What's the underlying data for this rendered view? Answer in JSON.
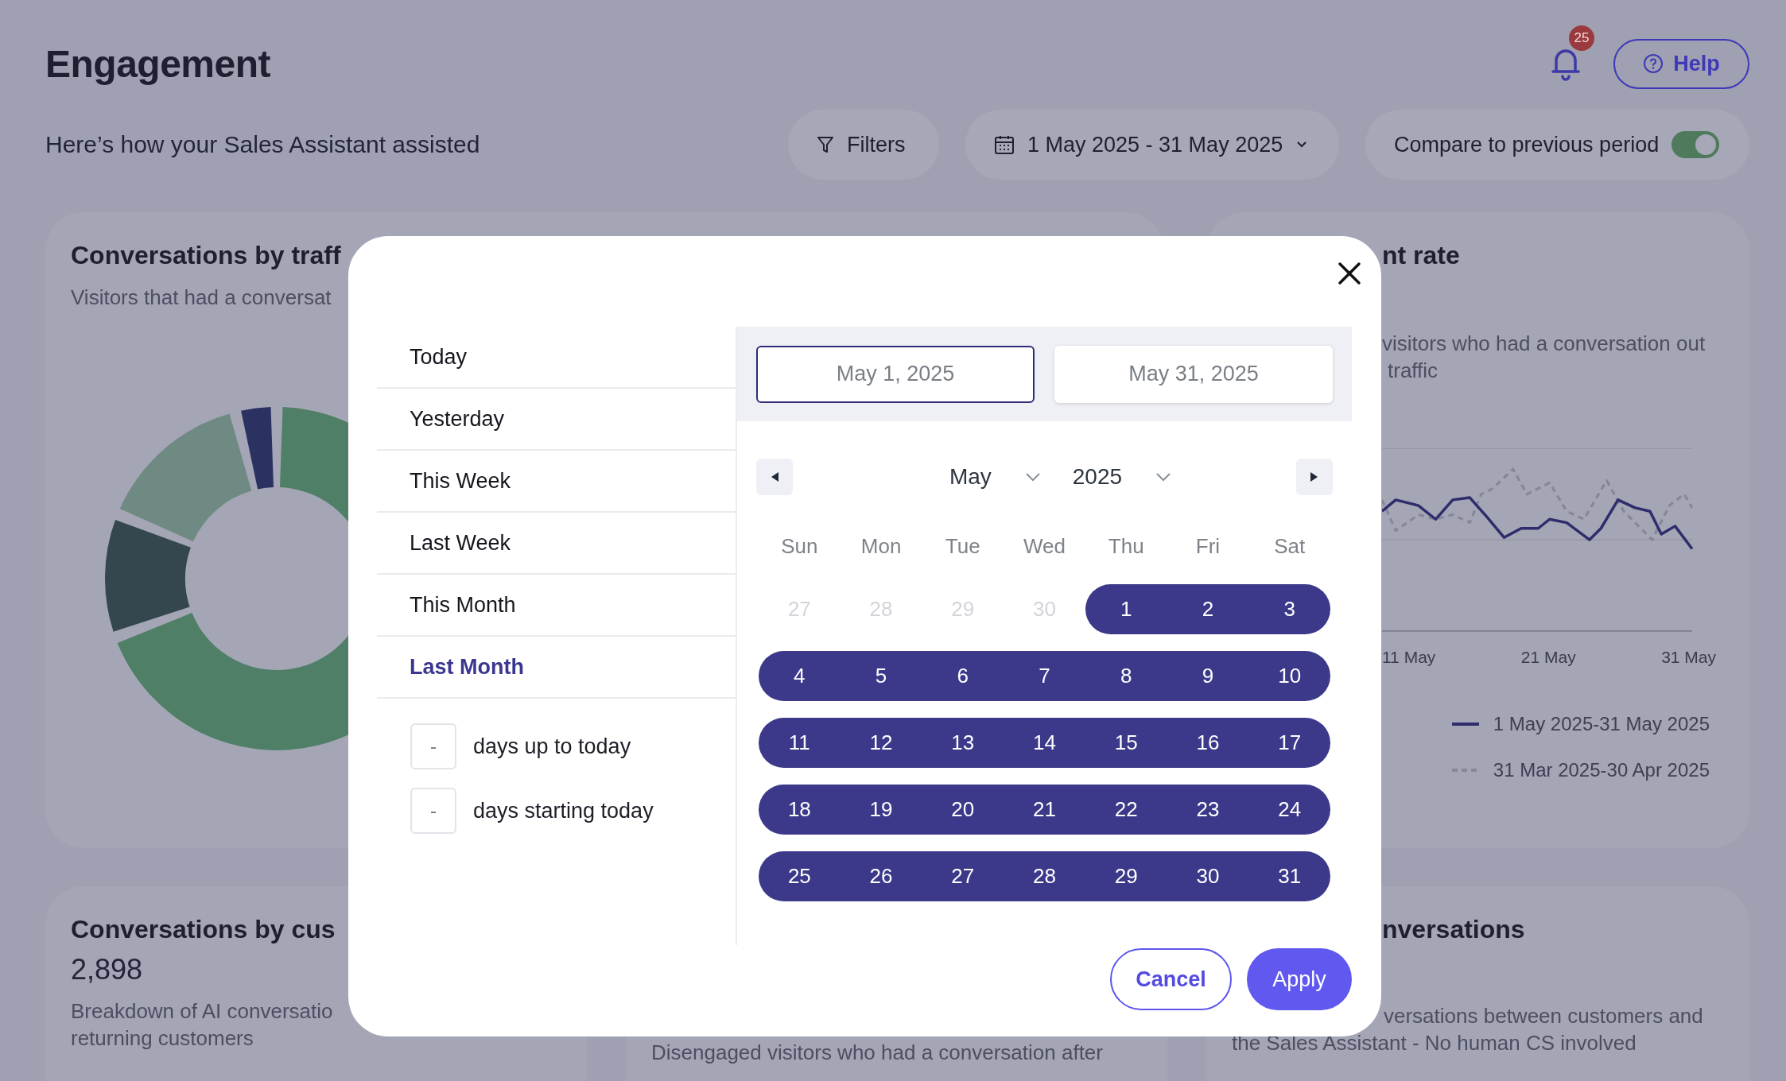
{
  "page": {
    "title": "Engagement",
    "subtitle": "Here’s how your Sales Assistant assisted"
  },
  "notifications": {
    "badge": "25"
  },
  "help_button": {
    "label": "Help"
  },
  "toolbar": {
    "filters": "Filters",
    "date_range": "1 May 2025 - 31 May 2025",
    "compare": {
      "label": "Compare to previous period",
      "on": true
    }
  },
  "traffic_card": {
    "title": "Conversations by traff",
    "subtitle": "Visitors that had a conversat"
  },
  "rate_card": {
    "title": "nt rate",
    "description_lines": [
      "visitors who had a conversation out",
      "traffic"
    ],
    "x_labels": [
      "11 May",
      "21 May",
      "31 May"
    ],
    "legend": [
      {
        "label": "1 May 2025-31 May 2025",
        "kind": "solid"
      },
      {
        "label": "31 Mar 2025-30 Apr 2025",
        "kind": "dashed"
      }
    ]
  },
  "customer_card": {
    "title": "Conversations by cus",
    "value": "2,898",
    "description_lines": [
      "Breakdown of AI conversatio",
      "returning customers"
    ]
  },
  "disengaged_card": {
    "description_lines": [
      "Disengaged visitors who had a conversation after"
    ]
  },
  "ai_only_card": {
    "title": "nversations",
    "description_lines": [
      "versations between customers and",
      "the Sales Assistant - No human CS involved"
    ]
  },
  "date_picker": {
    "presets": [
      {
        "label": "Today",
        "selected": false
      },
      {
        "label": "Yesterday",
        "selected": false
      },
      {
        "label": "This Week",
        "selected": false
      },
      {
        "label": "Last Week",
        "selected": false
      },
      {
        "label": "This Month",
        "selected": false
      },
      {
        "label": "Last Month",
        "selected": true
      }
    ],
    "relative": [
      {
        "placeholder": "-",
        "label": "days up to today"
      },
      {
        "placeholder": "-",
        "label": "days starting today"
      }
    ],
    "start_date": {
      "value": "May 1, 2025",
      "selected": true
    },
    "end_date": {
      "value": "May 31, 2025",
      "selected": false
    },
    "month": "May",
    "year": "2025",
    "weekdays": [
      "Sun",
      "Mon",
      "Tue",
      "Wed",
      "Thu",
      "Fri",
      "Sat"
    ],
    "weeks": [
      [
        {
          "day": "27",
          "outside": true,
          "selected": false
        },
        {
          "day": "28",
          "outside": true,
          "selected": false
        },
        {
          "day": "29",
          "outside": true,
          "selected": false
        },
        {
          "day": "30",
          "outside": true,
          "selected": false
        },
        {
          "day": "1",
          "outside": false,
          "selected": true
        },
        {
          "day": "2",
          "outside": false,
          "selected": true
        },
        {
          "day": "3",
          "outside": false,
          "selected": true
        }
      ],
      [
        {
          "day": "4",
          "outside": false,
          "selected": true
        },
        {
          "day": "5",
          "outside": false,
          "selected": true
        },
        {
          "day": "6",
          "outside": false,
          "selected": true
        },
        {
          "day": "7",
          "outside": false,
          "selected": true
        },
        {
          "day": "8",
          "outside": false,
          "selected": true
        },
        {
          "day": "9",
          "outside": false,
          "selected": true
        },
        {
          "day": "10",
          "outside": false,
          "selected": true
        }
      ],
      [
        {
          "day": "11",
          "outside": false,
          "selected": true
        },
        {
          "day": "12",
          "outside": false,
          "selected": true
        },
        {
          "day": "13",
          "outside": false,
          "selected": true
        },
        {
          "day": "14",
          "outside": false,
          "selected": true
        },
        {
          "day": "15",
          "outside": false,
          "selected": true
        },
        {
          "day": "16",
          "outside": false,
          "selected": true
        },
        {
          "day": "17",
          "outside": false,
          "selected": true
        }
      ],
      [
        {
          "day": "18",
          "outside": false,
          "selected": true
        },
        {
          "day": "19",
          "outside": false,
          "selected": true
        },
        {
          "day": "20",
          "outside": false,
          "selected": true
        },
        {
          "day": "21",
          "outside": false,
          "selected": true
        },
        {
          "day": "22",
          "outside": false,
          "selected": true
        },
        {
          "day": "23",
          "outside": false,
          "selected": true
        },
        {
          "day": "24",
          "outside": false,
          "selected": true
        }
      ],
      [
        {
          "day": "25",
          "outside": false,
          "selected": true
        },
        {
          "day": "26",
          "outside": false,
          "selected": true
        },
        {
          "day": "27",
          "outside": false,
          "selected": true
        },
        {
          "day": "28",
          "outside": false,
          "selected": true
        },
        {
          "day": "29",
          "outside": false,
          "selected": true
        },
        {
          "day": "30",
          "outside": false,
          "selected": true
        },
        {
          "day": "31",
          "outside": false,
          "selected": true
        }
      ]
    ],
    "buttons": {
      "cancel": "Cancel",
      "apply": "Apply"
    }
  }
}
